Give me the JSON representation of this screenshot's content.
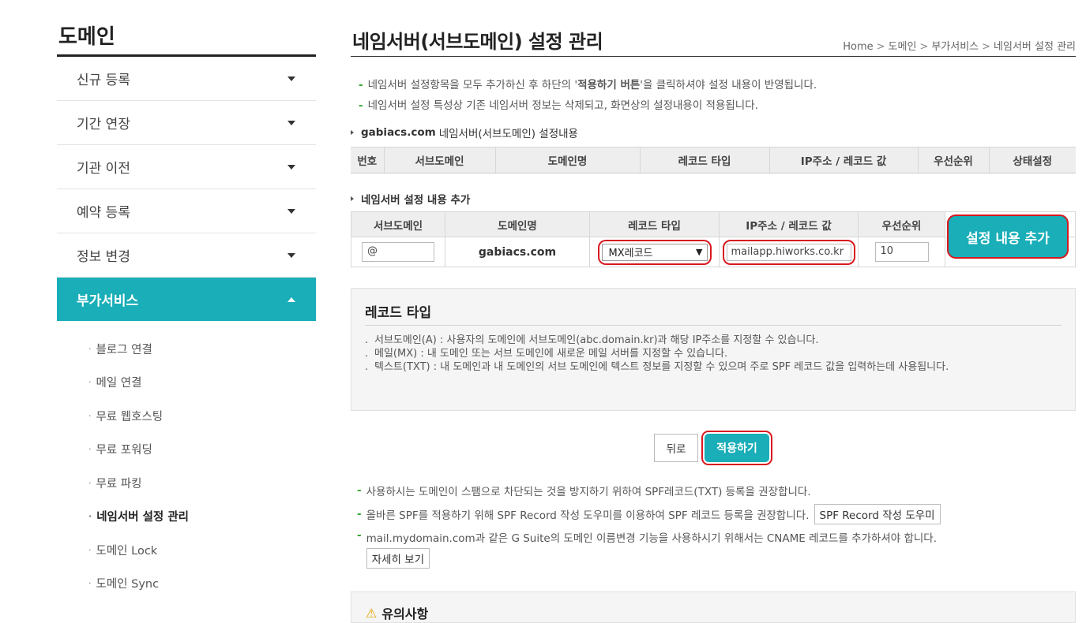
{
  "sidebar": {
    "title": "도메인",
    "items": [
      {
        "label": "신규 등록"
      },
      {
        "label": "기간 연장"
      },
      {
        "label": "기관 이전"
      },
      {
        "label": "예약 등록"
      },
      {
        "label": "정보 변경"
      }
    ],
    "active_item": {
      "label": "부가서비스"
    },
    "sub_items": [
      {
        "label": "블로그 연결"
      },
      {
        "label": "메일 연결"
      },
      {
        "label": "무료 웹호스팅"
      },
      {
        "label": "무료 포워딩"
      },
      {
        "label": "무료 파킹"
      },
      {
        "label": "네임서버 설정 관리"
      },
      {
        "label": "도메인 Lock"
      },
      {
        "label": "도메인 Sync"
      }
    ],
    "bullet": "·"
  },
  "header": {
    "title": "네임서버(서브도메인) 설정 관리",
    "breadcrumb": [
      "Home",
      "도메인",
      "부가서비스",
      "네임서버 설정 관리"
    ],
    "breadcrumb_sep": ">"
  },
  "notes": {
    "line1_a": "네임서버 설정항목을 모두 추가하신 후 하단의 '",
    "line1_b": "적용하기 버튼",
    "line1_c": "'을 클릭하셔야 설정 내용이 반영됩니다.",
    "line2": "네임서버 설정 특성상 기존 네임서버 정보는 삭제되고, 화면상의 설정내용이 적용됩니다."
  },
  "list_section": {
    "domain": "gabiacs.com",
    "label": "네임서버(서브도메인)  설정내용",
    "columns": [
      "번호",
      "서브도메인",
      "도메인명",
      "레코드 타입",
      "IP주소 / 레코드 값",
      "우선순위",
      "상태설정"
    ]
  },
  "add_section": {
    "label": "네임서버 설정 내용 추가",
    "columns": [
      "서브도메인",
      "도메인명",
      "레코드 타입",
      "IP주소 / 레코드 값",
      "우선순위"
    ],
    "subdomain_value": "@",
    "domain_name": "gabiacs.com",
    "record_type": "MX레코드",
    "record_value": "mailapp.hiworks.co.kr",
    "priority": "10",
    "add_button": "설정 내용 추가"
  },
  "info_box": {
    "title": "레코드 타입",
    "bullet": ".",
    "lines": [
      "서브도메인(A) : 사용자의 도메인에 서브도메인(abc.domain.kr)과 해당 IP주소를 지정할 수 있습니다.",
      "메일(MX) : 내 도메인 또는 서브 도메인에 새로운 메일 서버를 지정할 수 있습니다.",
      "텍스트(TXT) : 내 도메인과 내 도메인의 서브 도메인에 텍스트 정보를 지정할 수 있으며 주로 SPF 레코드 값을 입력하는데 사용됩니다."
    ]
  },
  "buttons": {
    "back": "뒤로",
    "apply": "적용하기"
  },
  "bottom_notes": {
    "line1": "사용하시는 도메인이 스팸으로 차단되는 것을 방지하기 위하여 SPF레코드(TXT) 등록을 권장합니다.",
    "line2": "올바른 SPF를 적용하기 위해 SPF Record 작성 도우미를 이용하여 SPF 레코드 등록을 권장합니다.",
    "spf_button": "SPF Record 작성 도우미",
    "line3": "mail.mydomain.com과 같은 G Suite의 도메인 이름변경 기능을 사용하시기 위해서는 CNAME 레코드를 추가하셔야 합니다.",
    "detail_button": "자세히 보기"
  },
  "caution": {
    "title": "유의사항"
  },
  "colors": {
    "accent": "#19aeb8",
    "highlight": "#d8181f",
    "dash": "#2ea62e"
  }
}
